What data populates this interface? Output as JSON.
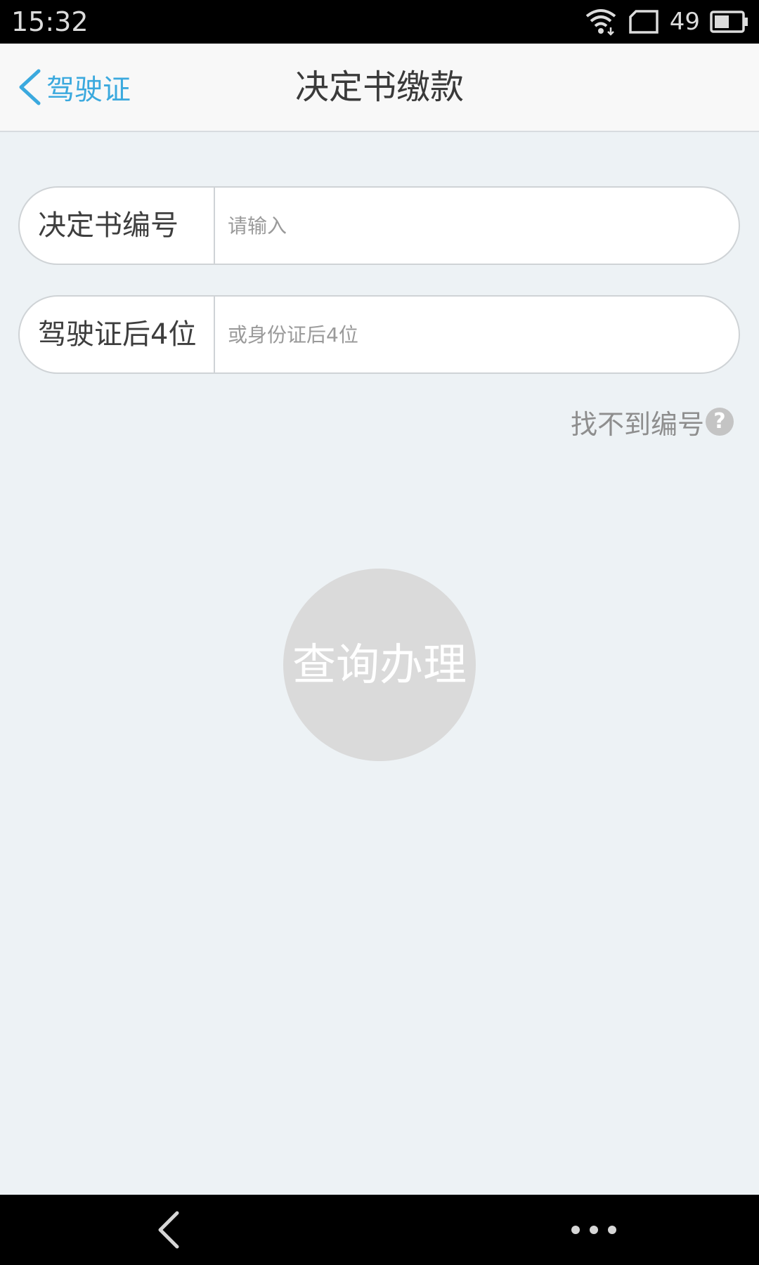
{
  "status_bar": {
    "time": "15:32",
    "battery_level": "49",
    "icons": [
      "wifi-icon",
      "sim-card-icon",
      "battery-icon"
    ]
  },
  "nav": {
    "back_label": "驾驶证",
    "title": "决定书缴款"
  },
  "form": {
    "decision_number": {
      "label": "决定书编号",
      "placeholder": "请输入",
      "value": ""
    },
    "license_last4": {
      "label": "驾驶证后4位",
      "placeholder": "或身份证后4位",
      "value": ""
    }
  },
  "help": {
    "text": "找不到编号",
    "icon": "?"
  },
  "query_button": {
    "label": "查询办理"
  },
  "bottom_nav": {
    "icons": [
      "back-arrow-icon",
      "more-dots-icon"
    ]
  },
  "colors": {
    "accent": "#3ba9de",
    "background": "#edf2f5",
    "button_disabled": "#dadada"
  }
}
